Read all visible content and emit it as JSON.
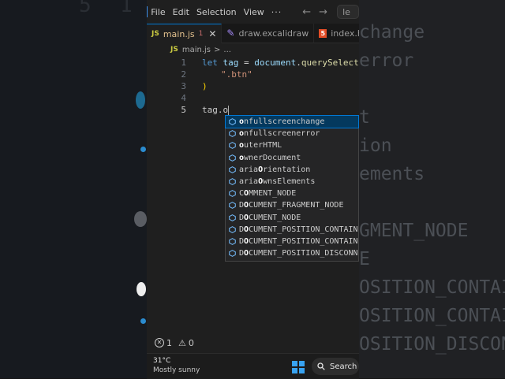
{
  "menu": {
    "file": "File",
    "edit": "Edit",
    "selection": "Selection",
    "view": "View",
    "more": "···"
  },
  "search_partial": "le",
  "tabs": [
    {
      "label": "main.js",
      "badge": "1",
      "icon": "js-file-icon"
    },
    {
      "label": "draw.excalidraw",
      "icon": "excalidraw-icon"
    },
    {
      "label": "index.h",
      "icon": "html5-icon"
    }
  ],
  "breadcrumb": {
    "file": "main.js",
    "sep": ">",
    "more": "..."
  },
  "code": {
    "line_numbers": [
      "1",
      "2",
      "3",
      "4",
      "5"
    ],
    "line1": {
      "kw": "let",
      "var": " tag",
      "op": " = ",
      "obj": "document",
      "dot": ".",
      "fn": "querySelector",
      "paren": "("
    },
    "line2": {
      "str": "\".btn\""
    },
    "line3": {
      "paren": ")"
    },
    "line5": {
      "text": "tag.o"
    }
  },
  "suggestions": [
    {
      "match": "o",
      "rest": "nfullscreenchange"
    },
    {
      "match": "o",
      "rest": "nfullscreenerror"
    },
    {
      "match": "o",
      "rest": "uterHTML"
    },
    {
      "match": "o",
      "rest": "wnerDocument"
    },
    {
      "match": "",
      "pre": "aria",
      "mid": "O",
      "rest": "rientation"
    },
    {
      "match": "",
      "pre": "aria",
      "mid": "O",
      "rest": "wnsElements"
    },
    {
      "match": "",
      "pre": "C",
      "mid": "O",
      "rest": "MMENT_NODE"
    },
    {
      "match": "",
      "pre": "D",
      "mid": "O",
      "rest": "CUMENT_FRAGMENT_NODE"
    },
    {
      "match": "",
      "pre": "D",
      "mid": "O",
      "rest": "CUMENT_NODE"
    },
    {
      "match": "",
      "pre": "D",
      "mid": "O",
      "rest": "CUMENT_POSITION_CONTAIN"
    },
    {
      "match": "",
      "pre": "D",
      "mid": "O",
      "rest": "CUMENT_POSITION_CONTAIN"
    },
    {
      "match": "",
      "pre": "D",
      "mid": "O",
      "rest": "CUMENT_POSITION_DISCONN"
    }
  ],
  "status": {
    "errors": "1",
    "warnings": "0"
  },
  "taskbar": {
    "temp": "31°C",
    "condition": "Mostly sunny",
    "search": "Search"
  },
  "background_right": [
    "change",
    "error",
    "t",
    "ion",
    "ements",
    "GMENT_NODE",
    "E",
    "OSITION_CONTAIN",
    "OSITION_CONTAIN",
    "OSITION_DISCONN"
  ],
  "background_left": [
    "5",
    "1"
  ],
  "colors": {
    "accent": "#0078d4",
    "keyword": "#569cd6",
    "variable": "#9cdcfe",
    "function": "#dcdcaa",
    "string": "#ce9178"
  }
}
